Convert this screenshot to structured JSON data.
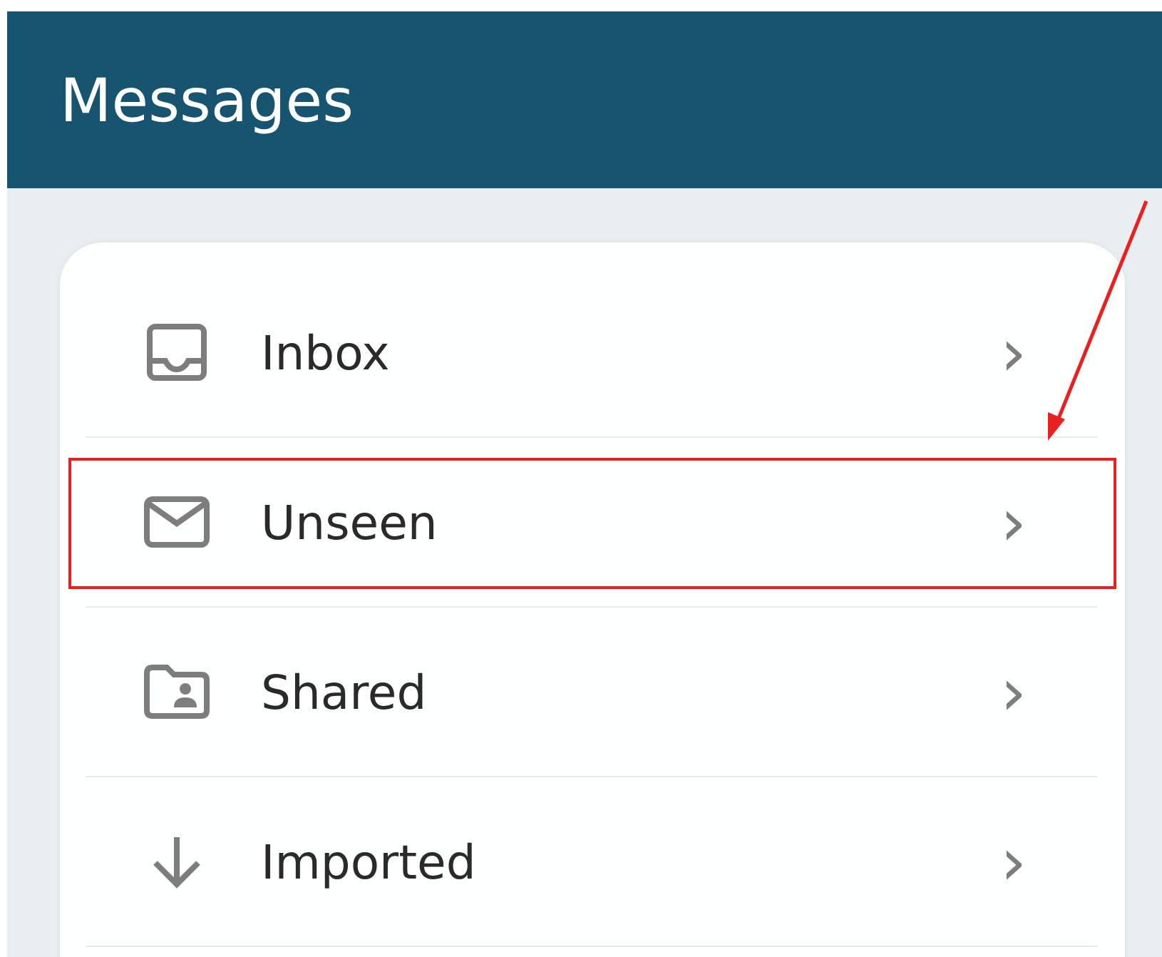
{
  "header": {
    "title": "Messages"
  },
  "items": [
    {
      "label": "Inbox",
      "kind": "inbox",
      "chevron": "›",
      "highlighted": false
    },
    {
      "label": "Unseen",
      "kind": "mail",
      "chevron": "›",
      "highlighted": true
    },
    {
      "label": "Shared",
      "kind": "shared",
      "chevron": "›",
      "highlighted": false
    },
    {
      "label": "Imported",
      "kind": "imported",
      "chevron": "›",
      "highlighted": false
    }
  ]
}
